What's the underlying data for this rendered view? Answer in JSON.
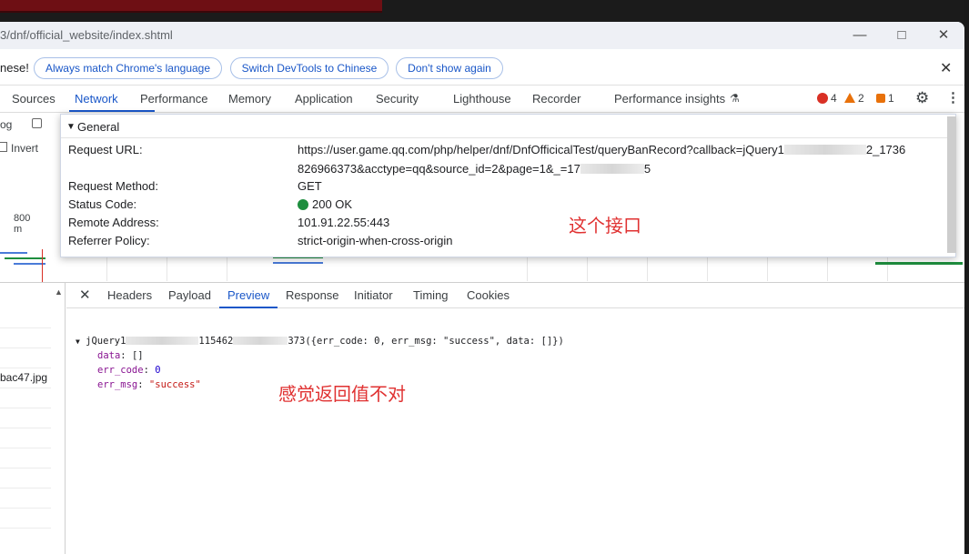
{
  "browser": {
    "url_fragment": "3/dnf/official_website/index.shtml"
  },
  "infobar": {
    "message": "nese!",
    "buttons": [
      "Always match Chrome's language",
      "Switch DevTools to Chinese",
      "Don't show again"
    ]
  },
  "devtools_tabs": [
    "Sources",
    "Network",
    "Performance",
    "Memory",
    "Application",
    "Security",
    "Lighthouse",
    "Recorder",
    "Performance insights"
  ],
  "counters": {
    "errors": "4",
    "warnings": "2",
    "issues": "1"
  },
  "left_panel": {
    "log_label": "og",
    "invert_label": "Invert",
    "time_label": "800 m"
  },
  "general": {
    "section_title": "General",
    "rows": [
      {
        "key": "Request URL:",
        "value": "https://user.game.qq.com/php/helper/dnf/DnfOfficicalTest/queryBanRecord?callback=jQuery1",
        "value_tail": "2_1736",
        "value_line2": "826966373&acctype=qq&source_id=2&page=1&_=17",
        "value_line2_tail": "5"
      },
      {
        "key": "Request Method:",
        "value": "GET"
      },
      {
        "key": "Status Code:",
        "value": "200 OK"
      },
      {
        "key": "Remote Address:",
        "value": "101.91.22.55:443"
      },
      {
        "key": "Referrer Policy:",
        "value": "strict-origin-when-cross-origin"
      }
    ]
  },
  "annotations": {
    "interface": "这个接口",
    "wrong_value": "感觉返回值不对"
  },
  "detail_tabs": [
    "Headers",
    "Payload",
    "Preview",
    "Response",
    "Initiator",
    "Timing",
    "Cookies"
  ],
  "request_list": {
    "file": "bac47.jpg"
  },
  "preview": {
    "head_prefix": "jQuery1",
    "head_mid": "115462",
    "head_suffix": "373({err_code: 0, err_msg: \"success\", data: []})",
    "fields": [
      {
        "key": "data",
        "value": "[]"
      },
      {
        "key": "err_code",
        "value": "0"
      },
      {
        "key": "err_msg",
        "value": "\"success\""
      }
    ]
  }
}
